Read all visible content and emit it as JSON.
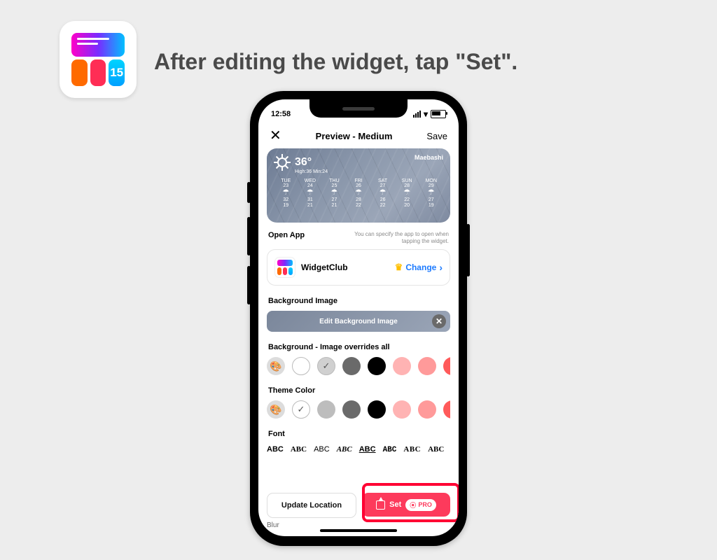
{
  "headline": "After editing the widget, tap \"Set\".",
  "appIcon": {
    "badge": "15"
  },
  "status": {
    "time": "12:58"
  },
  "nav": {
    "title": "Preview - Medium",
    "save": "Save"
  },
  "widget": {
    "location": "Maebashi",
    "temp": "36°",
    "hilo": "High:36  Min:24",
    "days": [
      {
        "d": "TUE",
        "dt": "23",
        "hi": "32",
        "lo": "19"
      },
      {
        "d": "WED",
        "dt": "24",
        "hi": "31",
        "lo": "21"
      },
      {
        "d": "THU",
        "dt": "25",
        "hi": "27",
        "lo": "21"
      },
      {
        "d": "FRI",
        "dt": "26",
        "hi": "28",
        "lo": "22"
      },
      {
        "d": "SAT",
        "dt": "27",
        "hi": "26",
        "lo": "22"
      },
      {
        "d": "SUN",
        "dt": "28",
        "hi": "22",
        "lo": "20"
      },
      {
        "d": "MON",
        "dt": "29",
        "hi": "27",
        "lo": "19"
      }
    ]
  },
  "openApp": {
    "label": "Open App",
    "hint": "You can specify the app to open when tapping the widget.",
    "name": "WidgetClub",
    "change": "Change"
  },
  "bgImage": {
    "label": "Background Image",
    "button": "Edit Background Image"
  },
  "bgColor": {
    "label": "Background - Image overrides all",
    "swatches": [
      "palette",
      "#ffffff",
      "#d0d0d0",
      "#6a6a6a",
      "#000000",
      "#ffb3b3",
      "#ff9a9a",
      "#ff5a5a"
    ],
    "selected": 2
  },
  "themeColor": {
    "label": "Theme Color",
    "swatches": [
      "palette",
      "#ffffff",
      "#bdbdbd",
      "#6a6a6a",
      "#000000",
      "#ffb3b3",
      "#ff9a9a",
      "#ff5a5a"
    ],
    "selected": 1
  },
  "font": {
    "label": "Font",
    "samples": [
      "ABC",
      "ABC",
      "ABC",
      "ABC",
      "ABC",
      "ABC",
      "ABC",
      "ABC"
    ]
  },
  "bottom": {
    "update": "Update Location",
    "set": "Set",
    "pro": "PRO",
    "blur": "Blur"
  }
}
